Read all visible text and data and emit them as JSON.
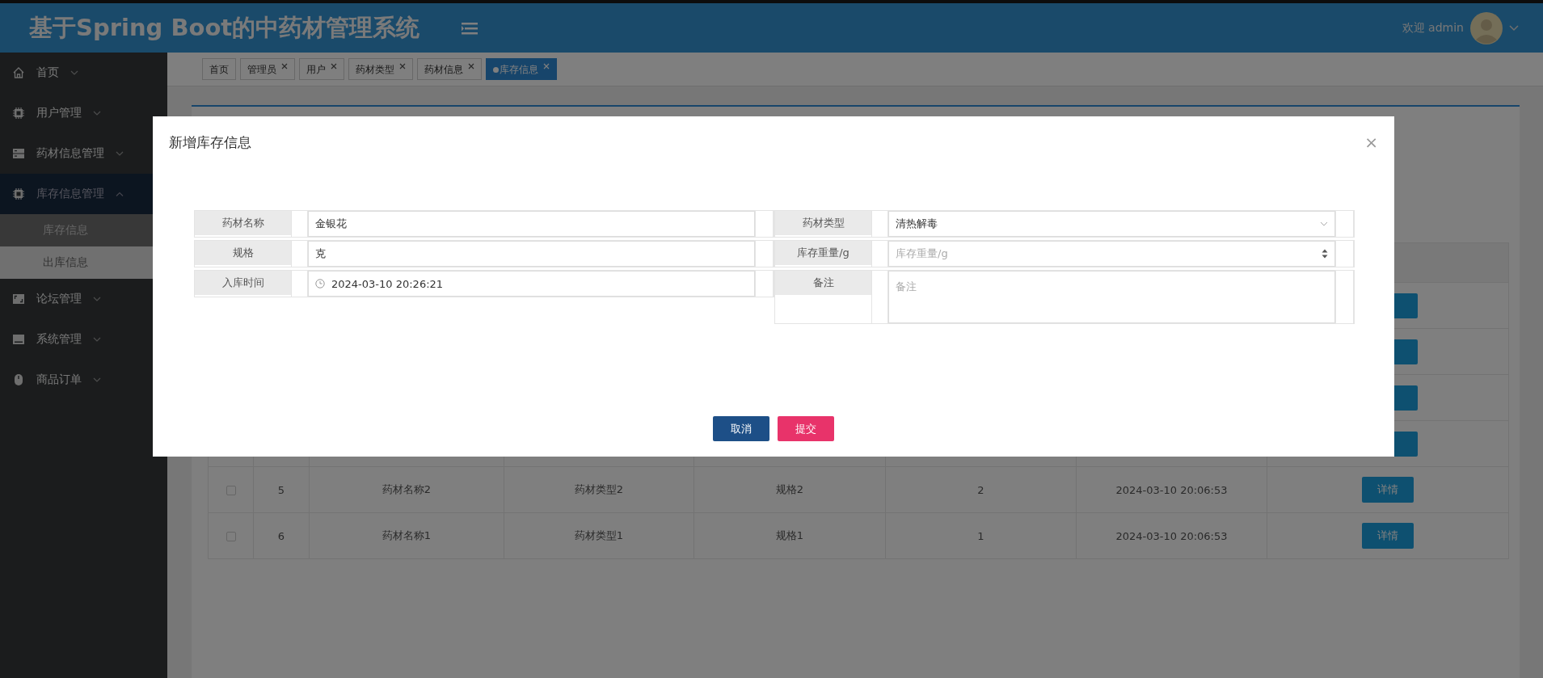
{
  "header": {
    "title": "基于Spring Boot的中药材管理系统",
    "welcome": "欢迎 admin"
  },
  "sidebar": {
    "items": [
      {
        "label": "首页",
        "expanded": false
      },
      {
        "label": "用户管理",
        "expanded": false
      },
      {
        "label": "药材信息管理",
        "expanded": false
      },
      {
        "label": "库存信息管理",
        "expanded": true,
        "children": [
          {
            "label": "库存信息",
            "selected": true,
            "hovered": false
          },
          {
            "label": "出库信息",
            "selected": false,
            "hovered": true
          }
        ]
      },
      {
        "label": "论坛管理",
        "expanded": false
      },
      {
        "label": "系统管理",
        "expanded": false
      },
      {
        "label": "商品订单",
        "expanded": false
      }
    ]
  },
  "tabs": [
    {
      "label": "首页",
      "closable": false,
      "selected": false
    },
    {
      "label": "管理员",
      "closable": true,
      "selected": false
    },
    {
      "label": "用户",
      "closable": true,
      "selected": false
    },
    {
      "label": "药材类型",
      "closable": true,
      "selected": false
    },
    {
      "label": "药材信息",
      "closable": true,
      "selected": false
    },
    {
      "label": "库存信息",
      "closable": true,
      "selected": true
    }
  ],
  "table": {
    "rows": [
      {
        "checked": false,
        "no": "5",
        "name": "药材名称2",
        "type": "药材类型2",
        "spec": "规格2",
        "weight": "2",
        "time": "2024-03-10 20:06:53",
        "action": "详情"
      },
      {
        "checked": false,
        "no": "6",
        "name": "药材名称1",
        "type": "药材类型1",
        "spec": "规格1",
        "weight": "1",
        "time": "2024-03-10 20:06:53",
        "action": "详情"
      }
    ]
  },
  "dialog": {
    "title": "新增库存信息",
    "close": "×",
    "left_fields": [
      {
        "label": "药材名称",
        "kind": "text",
        "value": "金银花"
      },
      {
        "label": "规格",
        "kind": "text",
        "value": "克"
      },
      {
        "label": "入库时间",
        "kind": "datetime",
        "value": "2024-03-10 20:26:21"
      }
    ],
    "right_fields": [
      {
        "label": "药材类型",
        "kind": "select",
        "value": "清热解毒"
      },
      {
        "label": "库存重量/g",
        "kind": "number",
        "placeholder": "库存重量/g"
      },
      {
        "label": "备注",
        "kind": "textarea",
        "placeholder": "备注"
      }
    ],
    "buttons": [
      {
        "label": "取消",
        "kind": "cancel"
      },
      {
        "label": "提交",
        "kind": "submit"
      }
    ]
  }
}
